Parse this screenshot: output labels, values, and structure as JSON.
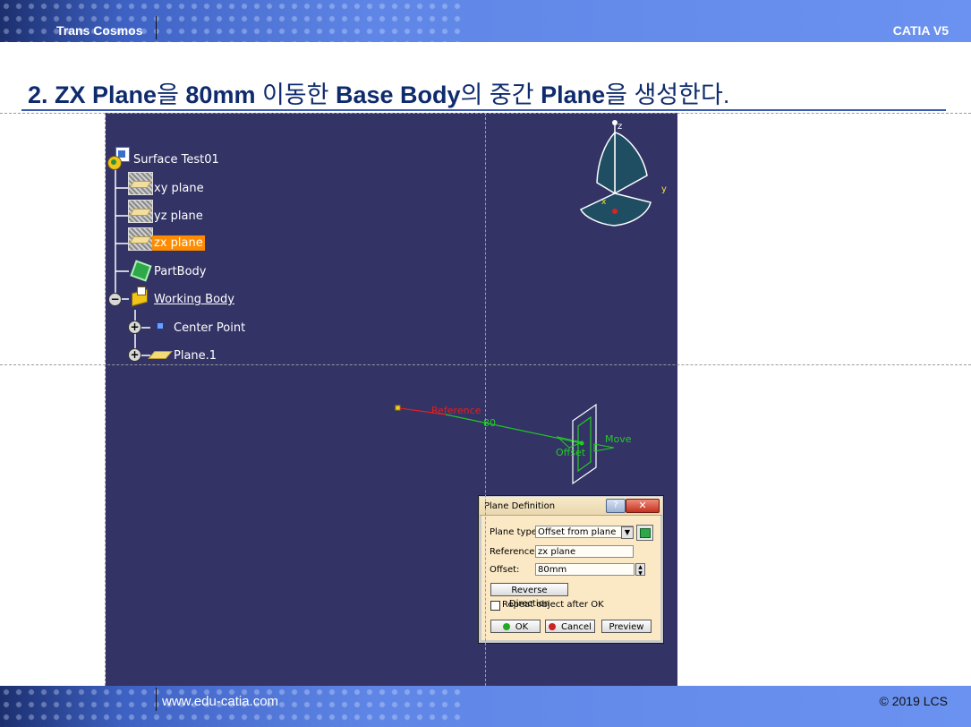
{
  "header": {
    "brand": "Trans Cosmos",
    "product": "CATIA V5"
  },
  "footer": {
    "url": "www.edu-catia.com",
    "copyright": "© 2019 LCS"
  },
  "title": {
    "p1": "2. ZX Plane",
    "p2": "을 ",
    "p3": "80mm",
    "p4": " 이동한 ",
    "p5": "Base Body",
    "p6": "의 중간 ",
    "p7": "Plane",
    "p8": "을 생성한다."
  },
  "tree": {
    "root": "Surface Test01",
    "xy": "xy plane",
    "yz": "yz plane",
    "zx": "zx plane",
    "partbody": "PartBody",
    "working": "Working Body",
    "center": "Center Point",
    "plane1": "Plane.1"
  },
  "compass": {
    "z": "z",
    "y": "y",
    "x": "x"
  },
  "viewport": {
    "reference": "Reference",
    "offset_value": "80",
    "move": "Move",
    "offset": "Offset"
  },
  "dialog": {
    "title": "Plane Definition",
    "help": "?",
    "close": "✕",
    "plane_type_label": "Plane type:",
    "plane_type_value": "Offset from plane",
    "reference_label": "Reference:",
    "reference_value": "zx plane",
    "offset_label": "Offset:",
    "offset_value": "80mm",
    "reverse": "Reverse Direction",
    "repeat": "Repeat object after OK",
    "ok": "OK",
    "cancel": "Cancel",
    "preview": "Preview"
  },
  "colors": {
    "viewport_bg": "#333366",
    "selection": "#ff8c00",
    "title_text": "#0f2b6e",
    "dialog_bg": "#fbe9c5",
    "preview_green": "#22cc22",
    "reference_red": "#dd2222"
  }
}
